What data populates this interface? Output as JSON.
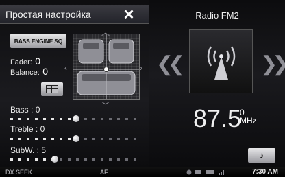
{
  "left_panel": {
    "title": "Простая настройка",
    "close_glyph": "✕",
    "bass_engine_label": "BASS ENGINE SQ",
    "fader_label": "Fader:",
    "fader_value": "0",
    "balance_label": "Balance:",
    "balance_value": "0",
    "sliders": [
      {
        "label": "Bass :",
        "value": "0",
        "level": 0.5
      },
      {
        "label": "Treble :",
        "value": "0",
        "level": 0.5
      },
      {
        "label": "SubW. :",
        "value": "5",
        "level": 0.34
      }
    ],
    "arrows": {
      "up": "︿",
      "down": "﹀",
      "left": "‹",
      "right": "›"
    }
  },
  "right_panel": {
    "source": "Radio FM2",
    "prev_glyph": "❮❮",
    "next_glyph": "❯❯",
    "frequency": "87.5",
    "band_top": "0",
    "band_unit": "MHz",
    "music_icon": "♪"
  },
  "status_bar": {
    "seek": "DX SEEK",
    "af": "AF",
    "time": "7:30 AM"
  },
  "icons": [
    "close-icon",
    "center-icon",
    "antenna-icon",
    "prev-icon",
    "next-icon",
    "music-note-icon",
    "bluetooth-icon",
    "battery-icon",
    "signal-icon"
  ]
}
